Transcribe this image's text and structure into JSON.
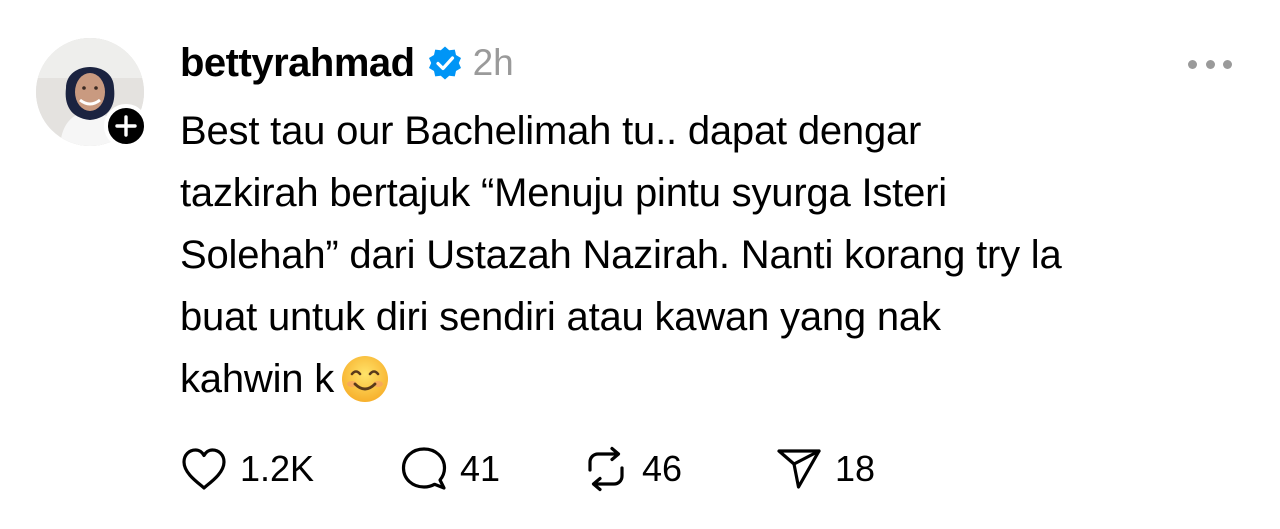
{
  "post": {
    "username": "bettyrahmad",
    "verified_icon": "verified-badge-icon",
    "time": "2h",
    "body_lines": [
      "Best tau our Bachelimah tu.. dapat dengar",
      "tazkirah bertajuk “Menuju pintu syurga Isteri",
      "Solehah” dari Ustazah Nazirah. Nanti korang try la",
      "buat untuk diri sendiri atau kawan yang nak",
      "kahwin k"
    ],
    "emoji": "smiling-face-emoji"
  },
  "actions": {
    "likes": "1.2K",
    "replies": "41",
    "reposts": "46",
    "shares": "18"
  },
  "colors": {
    "accent_verified": "#0095f6",
    "muted": "#9a9a9a",
    "text": "#000000"
  }
}
